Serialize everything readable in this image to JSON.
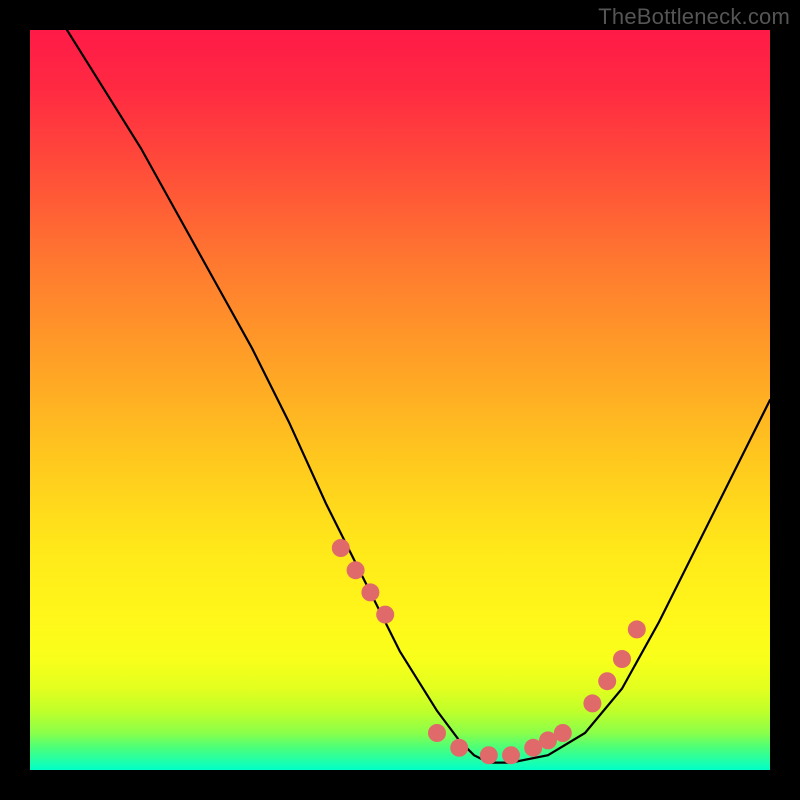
{
  "watermark": "TheBottleneck.com",
  "chart_data": {
    "type": "line",
    "title": "",
    "xlabel": "",
    "ylabel": "",
    "xlim": [
      0,
      100
    ],
    "ylim": [
      0,
      100
    ],
    "curve": {
      "x": [
        5,
        10,
        15,
        20,
        25,
        30,
        35,
        40,
        45,
        50,
        55,
        58,
        60,
        62,
        65,
        70,
        75,
        80,
        85,
        90,
        95,
        100
      ],
      "y": [
        100,
        92,
        84,
        75,
        66,
        57,
        47,
        36,
        26,
        16,
        8,
        4,
        2,
        1,
        1,
        2,
        5,
        11,
        20,
        30,
        40,
        50
      ]
    },
    "markers": {
      "x": [
        42,
        44,
        46,
        48,
        55,
        58,
        62,
        65,
        68,
        70,
        72,
        76,
        78,
        80,
        82
      ],
      "y": [
        30,
        27,
        24,
        21,
        5,
        3,
        2,
        2,
        3,
        4,
        5,
        9,
        12,
        15,
        19
      ]
    },
    "colors": {
      "curve": "#000000",
      "marker": "#e06a6a",
      "gradient_top": "#ff1a47",
      "gradient_bottom": "#00ffc8"
    }
  }
}
